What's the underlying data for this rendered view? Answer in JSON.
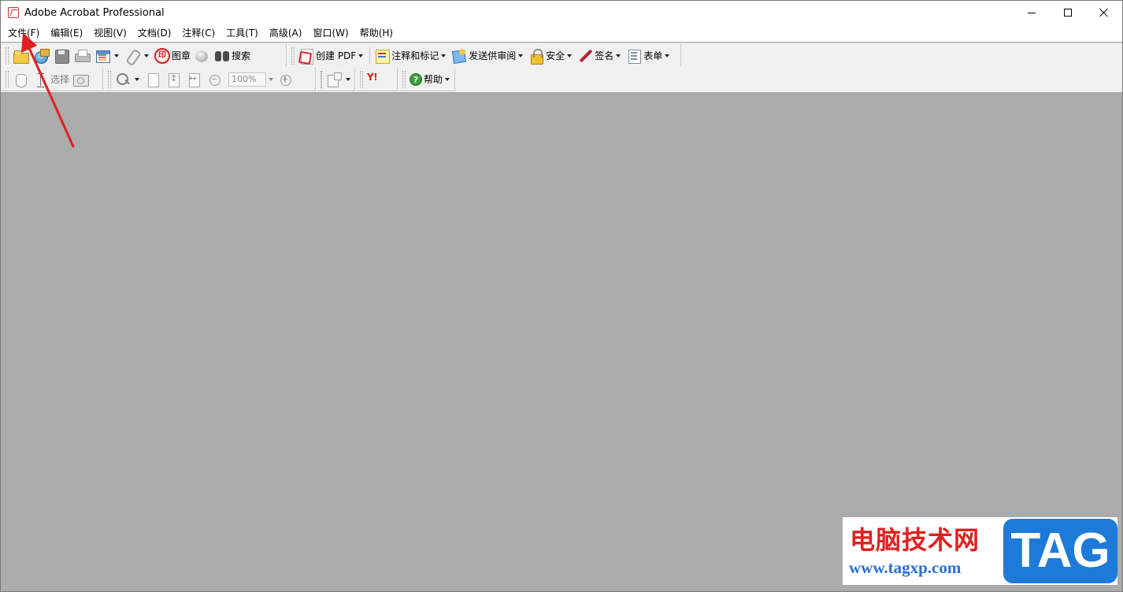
{
  "window": {
    "title": "Adobe Acrobat Professional"
  },
  "menubar": {
    "items": [
      "文件(F)",
      "编辑(E)",
      "视图(V)",
      "文档(D)",
      "注释(C)",
      "工具(T)",
      "高级(A)",
      "窗口(W)",
      "帮助(H)"
    ]
  },
  "toolbar1": {
    "stamp_label": "图章",
    "search_label": "搜索",
    "create_pdf_label": "创建 PDF",
    "annotate_label": "注释和标记",
    "review_label": "发送供审阅",
    "security_label": "安全",
    "sign_label": "签名",
    "forms_label": "表单"
  },
  "toolbar2": {
    "select_label": "选择",
    "zoom_value": "100%",
    "help_label": "帮助",
    "yahoo_label": "Y!"
  },
  "watermark": {
    "cn_text": "电脑技术网",
    "url_text": "www.tagxp.com",
    "tag_text": "TAG"
  },
  "annotation": {
    "arrow_color": "#e02020"
  },
  "colors": {
    "workspace": "#ababab",
    "toolbar": "#f0f0f0"
  }
}
